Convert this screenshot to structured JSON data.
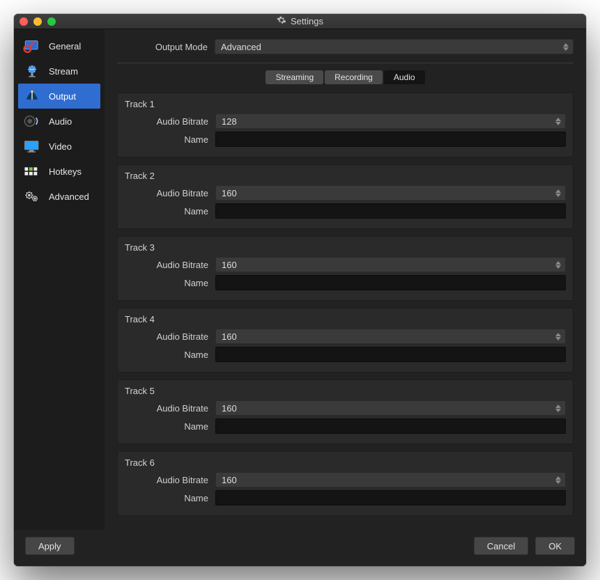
{
  "window": {
    "title": "Settings"
  },
  "sidebar": {
    "items": [
      {
        "label": "General"
      },
      {
        "label": "Stream"
      },
      {
        "label": "Output"
      },
      {
        "label": "Audio"
      },
      {
        "label": "Video"
      },
      {
        "label": "Hotkeys"
      },
      {
        "label": "Advanced"
      }
    ],
    "selected_index": 2
  },
  "output_mode": {
    "label": "Output Mode",
    "value": "Advanced"
  },
  "tabs": [
    {
      "label": "Streaming"
    },
    {
      "label": "Recording"
    },
    {
      "label": "Audio"
    }
  ],
  "active_tab_index": 2,
  "field_labels": {
    "audio_bitrate": "Audio Bitrate",
    "name": "Name"
  },
  "tracks": [
    {
      "title": "Track 1",
      "bitrate": "128",
      "name": ""
    },
    {
      "title": "Track 2",
      "bitrate": "160",
      "name": ""
    },
    {
      "title": "Track 3",
      "bitrate": "160",
      "name": ""
    },
    {
      "title": "Track 4",
      "bitrate": "160",
      "name": ""
    },
    {
      "title": "Track 5",
      "bitrate": "160",
      "name": ""
    },
    {
      "title": "Track 6",
      "bitrate": "160",
      "name": ""
    }
  ],
  "buttons": {
    "apply": "Apply",
    "cancel": "Cancel",
    "ok": "OK"
  }
}
